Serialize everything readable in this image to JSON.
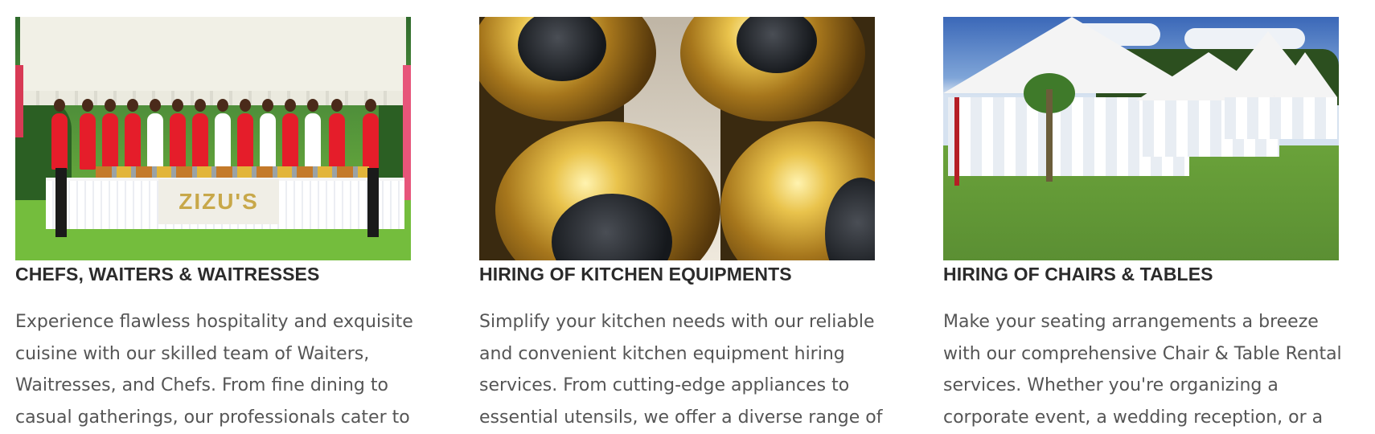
{
  "cards": [
    {
      "title": "CHEFS, WAITERS & WAITRESSES",
      "image_banner_text": "ZIZU'S",
      "description_lines": [
        "Experience flawless hospitality and exquisite",
        "cuisine with our skilled team of Waiters,",
        "Waitresses, and Chefs. From fine dining to",
        "casual gatherings, our professionals cater to"
      ]
    },
    {
      "title": "HIRING OF KITCHEN EQUIPMENTS",
      "description_lines": [
        "Simplify your kitchen needs with our reliable",
        "and convenient kitchen equipment hiring",
        "services. From cutting-edge appliances to",
        "essential utensils, we offer a diverse range of"
      ]
    },
    {
      "title": "HIRING OF CHAIRS & TABLES",
      "description_lines": [
        "Make your seating arrangements a breeze",
        "with our comprehensive Chair & Table Rental",
        "services. Whether you're organizing a",
        "corporate event, a wedding reception, or a"
      ]
    }
  ]
}
